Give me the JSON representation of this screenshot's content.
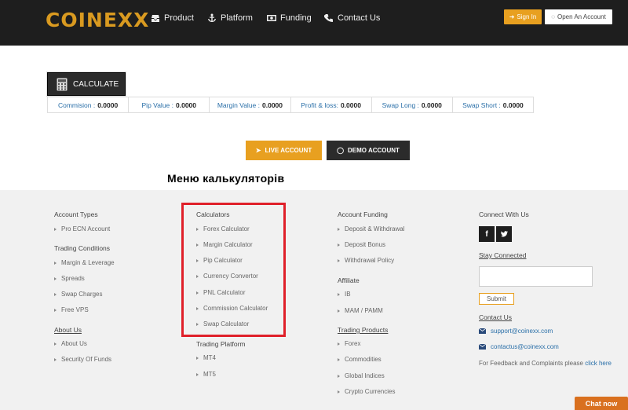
{
  "header": {
    "logo": "COINEXX",
    "nav": [
      {
        "label": "Product",
        "icon": "inbox-icon"
      },
      {
        "label": "Platform",
        "icon": "anchor-icon"
      },
      {
        "label": "Funding",
        "icon": "money-icon"
      },
      {
        "label": "Contact Us",
        "icon": "phone-icon"
      }
    ],
    "sign_in": "Sign In",
    "open_account": "Open An Account"
  },
  "calculator": {
    "button_label": "CALCULATE",
    "results": [
      {
        "label": "Commision :",
        "value": "0.0000"
      },
      {
        "label": "Pip Value :",
        "value": "0.0000"
      },
      {
        "label": "Margin Value :",
        "value": "0.0000"
      },
      {
        "label": "Profit & loss:",
        "value": "0.0000"
      },
      {
        "label": "Swap Long :",
        "value": "0.0000"
      },
      {
        "label": "Swap Short :",
        "value": "0.0000"
      }
    ]
  },
  "cta": {
    "live": "LIVE ACCOUNT",
    "demo": "DEMO ACCOUNT"
  },
  "annotation": "Меню калькуляторів",
  "footer": {
    "account_types": {
      "title": "Account Types",
      "items": [
        "Pro ECN Account"
      ]
    },
    "trading_conditions": {
      "title": "Trading Conditions",
      "items": [
        "Margin & Leverage",
        "Spreads",
        "Swap Charges",
        "Free VPS"
      ]
    },
    "about_us": {
      "title": "About Us",
      "items": [
        "About Us",
        "Security Of Funds"
      ]
    },
    "calculators": {
      "title": "Calculators",
      "items": [
        "Forex Calculator",
        "Margin Calculator",
        "Pip Calculator",
        "Currency Convertor",
        "PNL Calculator",
        "Commission Calculator",
        "Swap Calculator"
      ]
    },
    "trading_platform": {
      "title": "Trading Platform",
      "items": [
        "MT4",
        "MT5"
      ]
    },
    "account_funding": {
      "title": "Account Funding",
      "items": [
        "Deposit & Withdrawal",
        "Deposit Bonus",
        "Withdrawal Policy"
      ]
    },
    "affiliate": {
      "title": "Affiliate",
      "items": [
        "IB",
        "MAM / PAMM"
      ]
    },
    "trading_products": {
      "title": "Trading Products",
      "items": [
        "Forex",
        "Commodities",
        "Global Indices",
        "Crypto Currencies"
      ]
    },
    "connect": {
      "title": "Connect With Us",
      "facebook": "f"
    },
    "stay": {
      "title": "Stay Connected",
      "submit": "Submit"
    },
    "contact": {
      "title": "Contact Us",
      "support_email": "support@coinexx.com",
      "contact_email": "contactus@coinexx.com",
      "feedback_text": "For Feedback and Complaints please",
      "feedback_link": "click here"
    }
  },
  "chat": "Chat now",
  "colors": {
    "accent": "#e8a020",
    "dark": "#1e1e1e",
    "highlight": "#e0202a",
    "link": "#2a6fa8"
  }
}
